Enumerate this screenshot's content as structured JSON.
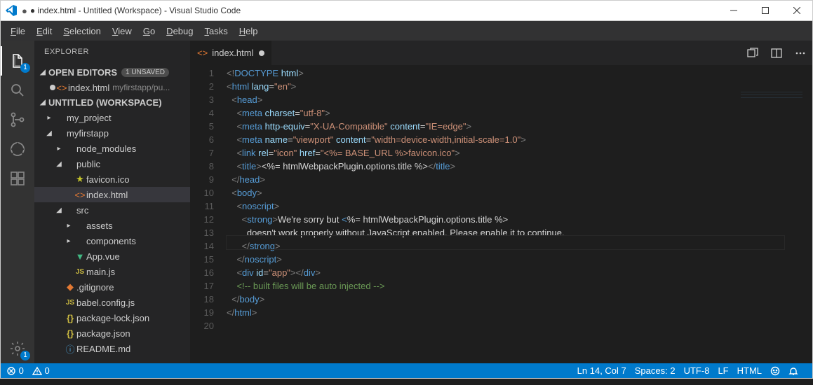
{
  "title": "● index.html - Untitled (Workspace) - Visual Studio Code",
  "menu": [
    "File",
    "Edit",
    "Selection",
    "View",
    "Go",
    "Debug",
    "Tasks",
    "Help"
  ],
  "sidebar": {
    "title": "EXPLORER",
    "open_editors": {
      "label": "OPEN EDITORS",
      "badge": "1 UNSAVED",
      "item": "index.html",
      "hint": "myfirstapp/pu..."
    },
    "workspace": "UNTITLED (WORKSPACE)",
    "tree": [
      {
        "d": 1,
        "t": "folder-closed",
        "n": "my_project"
      },
      {
        "d": 1,
        "t": "folder-open",
        "n": "myfirstapp"
      },
      {
        "d": 2,
        "t": "folder-closed",
        "n": "node_modules"
      },
      {
        "d": 2,
        "t": "folder-open",
        "n": "public"
      },
      {
        "d": 3,
        "t": "fav",
        "n": "favicon.ico"
      },
      {
        "d": 3,
        "t": "html",
        "n": "index.html",
        "sel": true
      },
      {
        "d": 2,
        "t": "folder-open",
        "n": "src"
      },
      {
        "d": 3,
        "t": "folder-closed",
        "n": "assets"
      },
      {
        "d": 3,
        "t": "folder-closed",
        "n": "components"
      },
      {
        "d": 3,
        "t": "vue",
        "n": "App.vue"
      },
      {
        "d": 3,
        "t": "js",
        "n": "main.js"
      },
      {
        "d": 2,
        "t": "git",
        "n": ".gitignore"
      },
      {
        "d": 2,
        "t": "js",
        "n": "babel.config.js"
      },
      {
        "d": 2,
        "t": "json",
        "n": "package-lock.json"
      },
      {
        "d": 2,
        "t": "json",
        "n": "package.json"
      },
      {
        "d": 2,
        "t": "info",
        "n": "README.md"
      }
    ]
  },
  "tab": {
    "name": "index.html"
  },
  "editor": {
    "lines": [
      [
        {
          "c": "gr",
          "t": "<!"
        },
        {
          "c": "b",
          "t": "DOCTYPE "
        },
        {
          "c": "lb",
          "t": "html"
        },
        {
          "c": "gr",
          "t": ">"
        }
      ],
      [
        {
          "c": "gr",
          "t": "<"
        },
        {
          "c": "b",
          "t": "html "
        },
        {
          "c": "lb",
          "t": "lang"
        },
        {
          "c": "d",
          "t": "="
        },
        {
          "c": "s",
          "t": "\"en\""
        },
        {
          "c": "gr",
          "t": ">"
        }
      ],
      [
        {
          "c": "",
          "t": "  "
        },
        {
          "c": "gr",
          "t": "<"
        },
        {
          "c": "b",
          "t": "head"
        },
        {
          "c": "gr",
          "t": ">"
        }
      ],
      [
        {
          "c": "",
          "t": "    "
        },
        {
          "c": "gr",
          "t": "<"
        },
        {
          "c": "b",
          "t": "meta "
        },
        {
          "c": "lb",
          "t": "charset"
        },
        {
          "c": "d",
          "t": "="
        },
        {
          "c": "s",
          "t": "\"utf-8\""
        },
        {
          "c": "gr",
          "t": ">"
        }
      ],
      [
        {
          "c": "",
          "t": "    "
        },
        {
          "c": "gr",
          "t": "<"
        },
        {
          "c": "b",
          "t": "meta "
        },
        {
          "c": "lb",
          "t": "http-equiv"
        },
        {
          "c": "d",
          "t": "="
        },
        {
          "c": "s",
          "t": "\"X-UA-Compatible\" "
        },
        {
          "c": "lb",
          "t": "content"
        },
        {
          "c": "d",
          "t": "="
        },
        {
          "c": "s",
          "t": "\"IE=edge\""
        },
        {
          "c": "gr",
          "t": ">"
        }
      ],
      [
        {
          "c": "",
          "t": "    "
        },
        {
          "c": "gr",
          "t": "<"
        },
        {
          "c": "b",
          "t": "meta "
        },
        {
          "c": "lb",
          "t": "name"
        },
        {
          "c": "d",
          "t": "="
        },
        {
          "c": "s",
          "t": "\"viewport\" "
        },
        {
          "c": "lb",
          "t": "content"
        },
        {
          "c": "d",
          "t": "="
        },
        {
          "c": "s",
          "t": "\"width=device-width,initial-scale=1.0\""
        },
        {
          "c": "gr",
          "t": ">"
        }
      ],
      [
        {
          "c": "",
          "t": "    "
        },
        {
          "c": "gr",
          "t": "<"
        },
        {
          "c": "b",
          "t": "link "
        },
        {
          "c": "lb",
          "t": "rel"
        },
        {
          "c": "d",
          "t": "="
        },
        {
          "c": "s",
          "t": "\"icon\" "
        },
        {
          "c": "lb",
          "t": "href"
        },
        {
          "c": "d",
          "t": "="
        },
        {
          "c": "s",
          "t": "\"<%= BASE_URL %>favicon.ico\""
        },
        {
          "c": "gr",
          "t": ">"
        }
      ],
      [
        {
          "c": "",
          "t": "    "
        },
        {
          "c": "gr",
          "t": "<"
        },
        {
          "c": "b",
          "t": "title"
        },
        {
          "c": "gr",
          "t": ">"
        },
        {
          "c": "d",
          "t": "<%= htmlWebpackPlugin.options.title %>"
        },
        {
          "c": "gr",
          "t": "</"
        },
        {
          "c": "b",
          "t": "title"
        },
        {
          "c": "gr",
          "t": ">"
        }
      ],
      [
        {
          "c": "",
          "t": "  "
        },
        {
          "c": "gr",
          "t": "</"
        },
        {
          "c": "b",
          "t": "head"
        },
        {
          "c": "gr",
          "t": ">"
        }
      ],
      [
        {
          "c": "",
          "t": "  "
        },
        {
          "c": "gr",
          "t": "<"
        },
        {
          "c": "b",
          "t": "body"
        },
        {
          "c": "gr",
          "t": ">"
        }
      ],
      [
        {
          "c": "",
          "t": "    "
        },
        {
          "c": "gr",
          "t": "<"
        },
        {
          "c": "b",
          "t": "noscript"
        },
        {
          "c": "gr",
          "t": ">"
        }
      ],
      [
        {
          "c": "",
          "t": "      "
        },
        {
          "c": "gr",
          "t": "<"
        },
        {
          "c": "b",
          "t": "strong"
        },
        {
          "c": "gr",
          "t": ">"
        },
        {
          "c": "d",
          "t": "We're sorry but "
        },
        {
          "c": "b",
          "t": "<"
        },
        {
          "c": "d",
          "t": "%= htmlWebpackPlugin.options.title %>"
        }
      ],
      [
        {
          "c": "",
          "t": "        "
        },
        {
          "c": "d",
          "t": "doesn't work properly without JavaScript enabled. Please enable it to continue."
        }
      ],
      [
        {
          "c": "",
          "t": "      "
        },
        {
          "c": "gr",
          "t": "</"
        },
        {
          "c": "b",
          "t": "strong"
        },
        {
          "c": "gr",
          "t": ">"
        }
      ],
      [
        {
          "c": "",
          "t": "    "
        },
        {
          "c": "gr",
          "t": "</"
        },
        {
          "c": "b",
          "t": "noscript"
        },
        {
          "c": "gr",
          "t": ">"
        }
      ],
      [
        {
          "c": "",
          "t": "    "
        },
        {
          "c": "gr",
          "t": "<"
        },
        {
          "c": "b",
          "t": "div "
        },
        {
          "c": "lb",
          "t": "id"
        },
        {
          "c": "d",
          "t": "="
        },
        {
          "c": "s",
          "t": "\"app\""
        },
        {
          "c": "gr",
          "t": "></"
        },
        {
          "c": "b",
          "t": "div"
        },
        {
          "c": "gr",
          "t": ">"
        }
      ],
      [
        {
          "c": "",
          "t": "    "
        },
        {
          "c": "g",
          "t": "<!-- built files will be auto injected -->"
        }
      ],
      [
        {
          "c": "",
          "t": "  "
        },
        {
          "c": "gr",
          "t": "</"
        },
        {
          "c": "b",
          "t": "body"
        },
        {
          "c": "gr",
          "t": ">"
        }
      ],
      [
        {
          "c": "gr",
          "t": "</"
        },
        {
          "c": "b",
          "t": "html"
        },
        {
          "c": "gr",
          "t": ">"
        }
      ],
      [
        {
          "c": "",
          "t": ""
        }
      ]
    ]
  },
  "status": {
    "errors": "0",
    "warnings": "0",
    "pos": "Ln 14, Col 7",
    "spaces": "Spaces: 2",
    "enc": "UTF-8",
    "eol": "LF",
    "lang": "HTML"
  },
  "badges": {
    "explorer": "1",
    "settings": "1"
  }
}
